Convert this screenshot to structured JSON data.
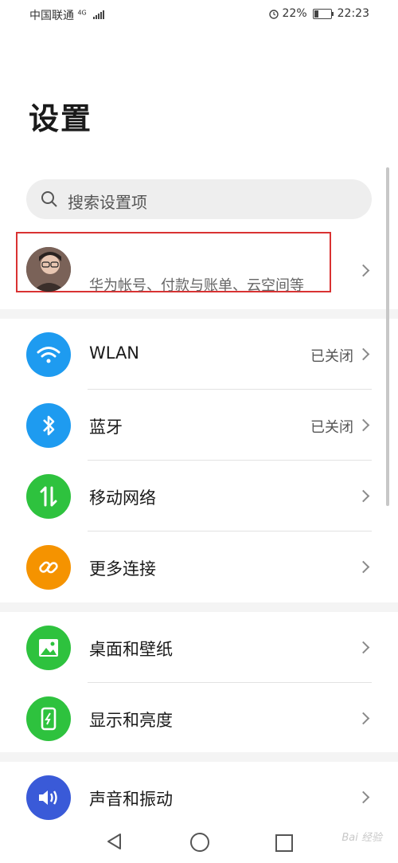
{
  "status_bar": {
    "carrier": "中国联通",
    "network": "4G",
    "battery": "22%",
    "time": "22:23"
  },
  "page_title": "设置",
  "search": {
    "placeholder": "搜索设置项"
  },
  "account": {
    "subtitle": "华为帐号、付款与账单、云空间等"
  },
  "groups": [
    {
      "items": [
        {
          "label": "WLAN",
          "value": "已关闭",
          "icon": "wifi-icon",
          "color": "#1e9bf0"
        },
        {
          "label": "蓝牙",
          "value": "已关闭",
          "icon": "bluetooth-icon",
          "color": "#1e9bf0"
        },
        {
          "label": "移动网络",
          "value": "",
          "icon": "mobile-network-icon",
          "color": "#2ec23e"
        },
        {
          "label": "更多连接",
          "value": "",
          "icon": "link-icon",
          "color": "#f59300"
        }
      ]
    },
    {
      "items": [
        {
          "label": "桌面和壁纸",
          "value": "",
          "icon": "wallpaper-icon",
          "color": "#2ec23e"
        },
        {
          "label": "显示和亮度",
          "value": "",
          "icon": "display-icon",
          "color": "#2ec23e"
        }
      ]
    },
    {
      "items": [
        {
          "label": "声音和振动",
          "value": "",
          "icon": "sound-icon",
          "color": "#3a5ad8"
        }
      ]
    }
  ],
  "watermark": "Bai 经验"
}
